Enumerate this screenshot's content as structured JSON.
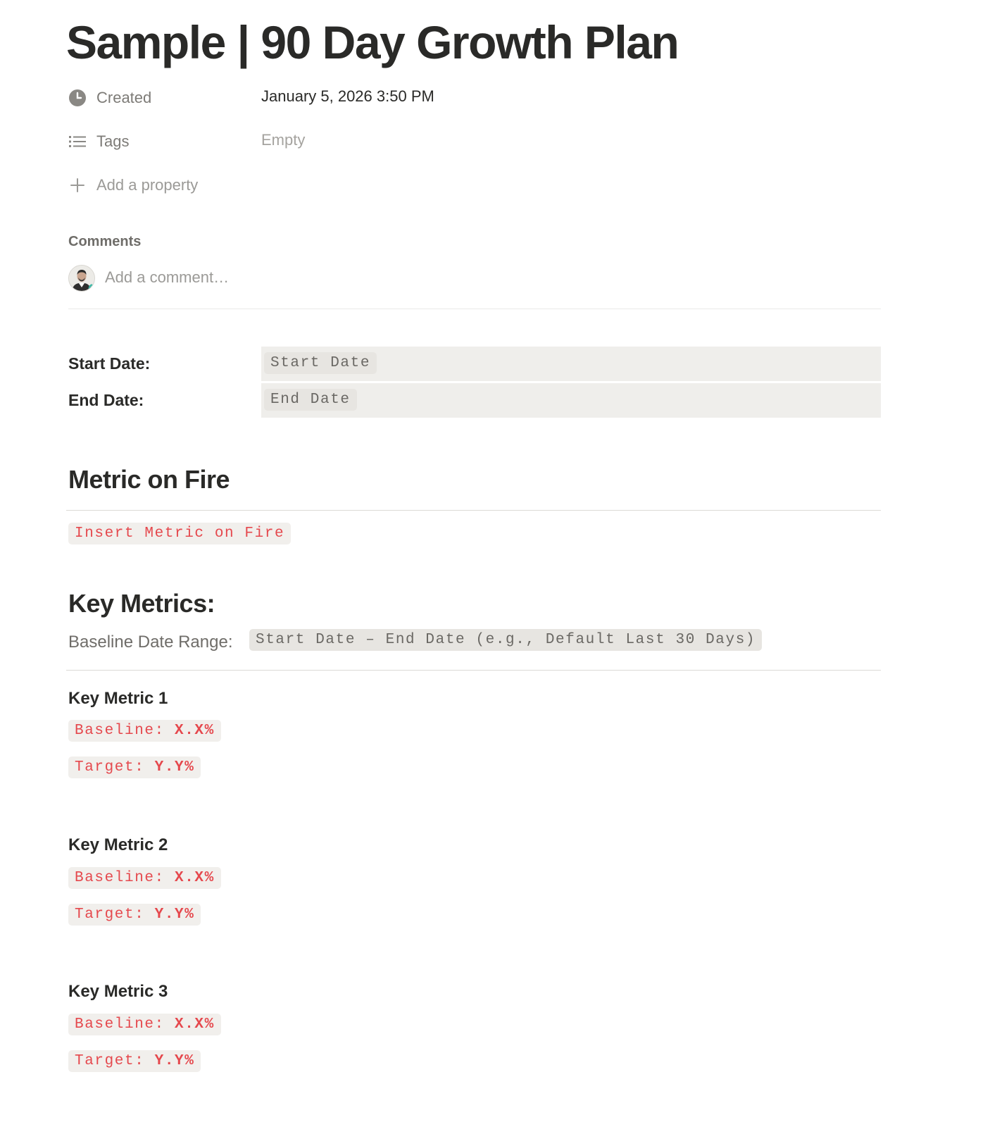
{
  "page": {
    "title": "Sample | 90 Day Growth Plan"
  },
  "properties": {
    "created": {
      "label": "Created",
      "value": "January 5, 2026 3:50 PM",
      "icon": "clock-icon"
    },
    "tags": {
      "label": "Tags",
      "value": "Empty",
      "icon": "list-icon"
    },
    "add_property": {
      "label": "Add a property",
      "icon": "plus-icon"
    }
  },
  "comments": {
    "heading": "Comments",
    "placeholder": "Add a comment…"
  },
  "dates": {
    "start_label": "Start Date:",
    "start_value": "Start Date",
    "end_label": "End Date:",
    "end_value": "End Date"
  },
  "metric_on_fire": {
    "heading": "Metric on Fire",
    "value": "Insert Metric on Fire"
  },
  "key_metrics": {
    "heading": "Key Metrics:",
    "baseline_label": "Baseline Date Range:",
    "baseline_value": "Start Date – End Date (e.g., Default Last 30 Days)",
    "items": [
      {
        "title": "Key Metric 1",
        "baseline_prefix": "Baseline:",
        "baseline_value": "X.X%",
        "target_prefix": "Target:",
        "target_value": "Y.Y%"
      },
      {
        "title": "Key Metric 2",
        "baseline_prefix": "Baseline:",
        "baseline_value": "X.X%",
        "target_prefix": "Target:",
        "target_value": "Y.Y%"
      },
      {
        "title": "Key Metric 3",
        "baseline_prefix": "Baseline:",
        "baseline_value": "X.X%",
        "target_prefix": "Target:",
        "target_value": "Y.Y%"
      }
    ]
  },
  "colors": {
    "code_red": "#e5484d",
    "code_bg": "#e7e5e1",
    "cell_bg": "#efeeeb"
  }
}
